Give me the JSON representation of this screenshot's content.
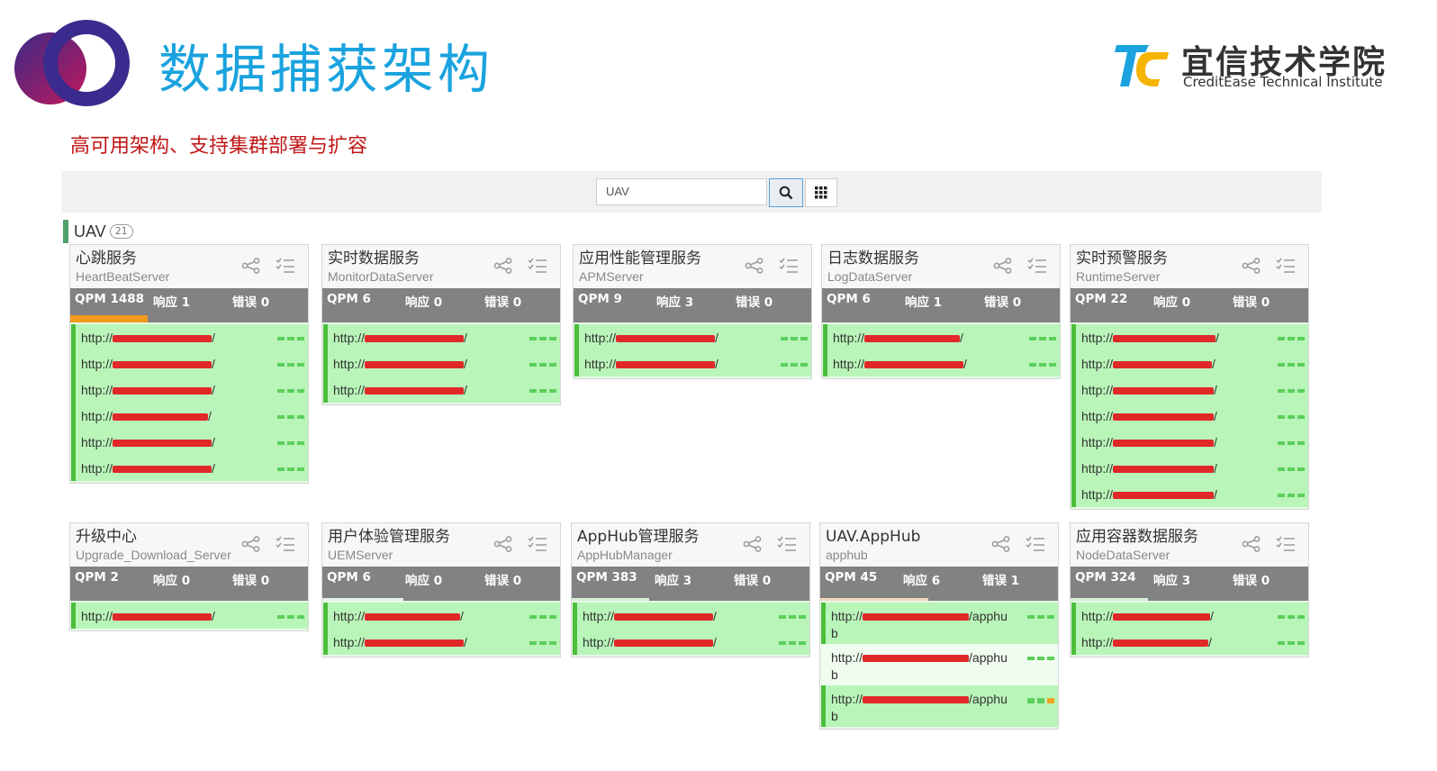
{
  "header": {
    "title": "数据捕获架构",
    "subtitle": "高可用架构、支持集群部署与扩容",
    "brand_cn": "宜信技术学院",
    "brand_en": "CreditEase Technical Institute"
  },
  "toolbar": {
    "search_value": "UAV"
  },
  "group": {
    "name": "UAV",
    "count": "21"
  },
  "colors": {
    "title_blue": "#1aa3de",
    "subtitle_red": "#c01818",
    "stat_gray": "#828282",
    "endpoint_green": "#b9f5b9",
    "endpoint_border": "#4bbe3c",
    "progress_orange": "#f29a1e",
    "redact_red": "#e02828"
  },
  "cards": [
    {
      "name": "心跳服务",
      "code": "HeartBeatServer",
      "qpm": "QPM 1488",
      "resp": "响应 1",
      "err": "错误 0",
      "endpoints": [
        {
          "prefix": "http://",
          "suffix": "/"
        },
        {
          "prefix": "http://",
          "suffix": "/"
        },
        {
          "prefix": "http://",
          "suffix": "/"
        },
        {
          "prefix": "http://",
          "suffix": "/"
        },
        {
          "prefix": "http://",
          "suffix": "/"
        },
        {
          "prefix": "http://",
          "suffix": "/"
        }
      ]
    },
    {
      "name": "实时数据服务",
      "code": "MonitorDataServer",
      "qpm": "QPM 6",
      "resp": "响应 0",
      "err": "错误 0",
      "endpoints": [
        {
          "prefix": "http://",
          "suffix": "/"
        },
        {
          "prefix": "http://",
          "suffix": "/"
        },
        {
          "prefix": "http://",
          "suffix": "/"
        }
      ]
    },
    {
      "name": "应用性能管理服务",
      "code": "APMServer",
      "qpm": "QPM 9",
      "resp": "响应 3",
      "err": "错误 0",
      "endpoints": [
        {
          "prefix": "http://",
          "suffix": "/"
        },
        {
          "prefix": "http://",
          "suffix": "/"
        }
      ]
    },
    {
      "name": "日志数据服务",
      "code": "LogDataServer",
      "qpm": "QPM 6",
      "resp": "响应 1",
      "err": "错误 0",
      "endpoints": [
        {
          "prefix": "http://",
          "suffix": "/"
        },
        {
          "prefix": "http://",
          "suffix": "/"
        }
      ]
    },
    {
      "name": "实时预警服务",
      "code": "RuntimeServer",
      "qpm": "QPM 22",
      "resp": "响应 0",
      "err": "错误 0",
      "endpoints": [
        {
          "prefix": "http://",
          "suffix": "/"
        },
        {
          "prefix": "http://",
          "suffix": "/"
        },
        {
          "prefix": "http://",
          "suffix": "/"
        },
        {
          "prefix": "http://",
          "suffix": "/"
        },
        {
          "prefix": "http://",
          "suffix": "/"
        },
        {
          "prefix": "http://",
          "suffix": "/"
        },
        {
          "prefix": "http://",
          "suffix": "/"
        }
      ]
    },
    {
      "name": "升级中心",
      "code": "Upgrade_Download_Server",
      "qpm": "QPM 2",
      "resp": "响应 0",
      "err": "错误 0",
      "endpoints": [
        {
          "prefix": "http://",
          "suffix": "/"
        }
      ]
    },
    {
      "name": "用户体验管理服务",
      "code": "UEMServer",
      "qpm": "QPM 6",
      "resp": "响应 0",
      "err": "错误 0",
      "endpoints": [
        {
          "prefix": "http://",
          "suffix": "/"
        },
        {
          "prefix": "http://",
          "suffix": "/"
        }
      ]
    },
    {
      "name": "AppHub管理服务",
      "code": "AppHubManager",
      "qpm": "QPM 383",
      "resp": "响应 3",
      "err": "错误 0",
      "endpoints": [
        {
          "prefix": "http://",
          "suffix": "/"
        },
        {
          "prefix": "http://",
          "suffix": "/"
        }
      ]
    },
    {
      "name": "UAV.AppHub",
      "code": "apphub",
      "qpm": "QPM 45",
      "resp": "响应 6",
      "err": "错误 1",
      "endpoints": [
        {
          "prefix": "http://",
          "suffix": "/apphub"
        },
        {
          "prefix": "http://",
          "suffix": "/apphub"
        },
        {
          "prefix": "http://",
          "suffix": "/apphub"
        }
      ]
    },
    {
      "name": "应用容器数据服务",
      "code": "NodeDataServer",
      "qpm": "QPM 324",
      "resp": "响应 3",
      "err": "错误 0",
      "endpoints": [
        {
          "prefix": "http://",
          "suffix": "/"
        },
        {
          "prefix": "http://",
          "suffix": "/"
        }
      ]
    }
  ]
}
